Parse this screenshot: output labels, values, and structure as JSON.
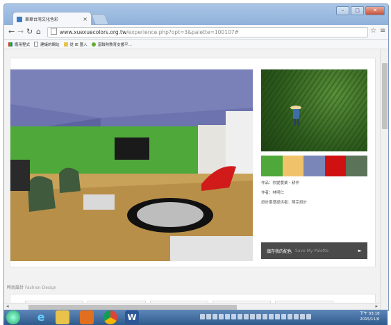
{
  "browser": {
    "tab_title": "華華台灣文化色彩",
    "tab_close": "×",
    "url_host": "www.xuexuecolors.org.tw",
    "url_path": "/experience.php?opt=3&palette=100107#",
    "bookmarks": [
      "應用程式",
      "建議的網站",
      "從 IE 匯入",
      "富聯熱教育支援平..."
    ]
  },
  "palette": {
    "colors": [
      "#4fa83a",
      "#f0c36a",
      "#7b86b8",
      "#cf1111",
      "#5b7359"
    ],
    "info_lines": [
      "作品：你變農業・耕作",
      "作者：林明仁",
      "設計靈感提供者：陳宗設計"
    ],
    "save_label": "儲存我的配色",
    "save_label_en": "Save My Palette",
    "save_arrow": "►"
  },
  "section": {
    "title": "時尚設計",
    "title_en": "Fashion Design"
  },
  "taskbar": {
    "clock_time": "下午 03:18",
    "clock_date": "2015/11/6"
  }
}
